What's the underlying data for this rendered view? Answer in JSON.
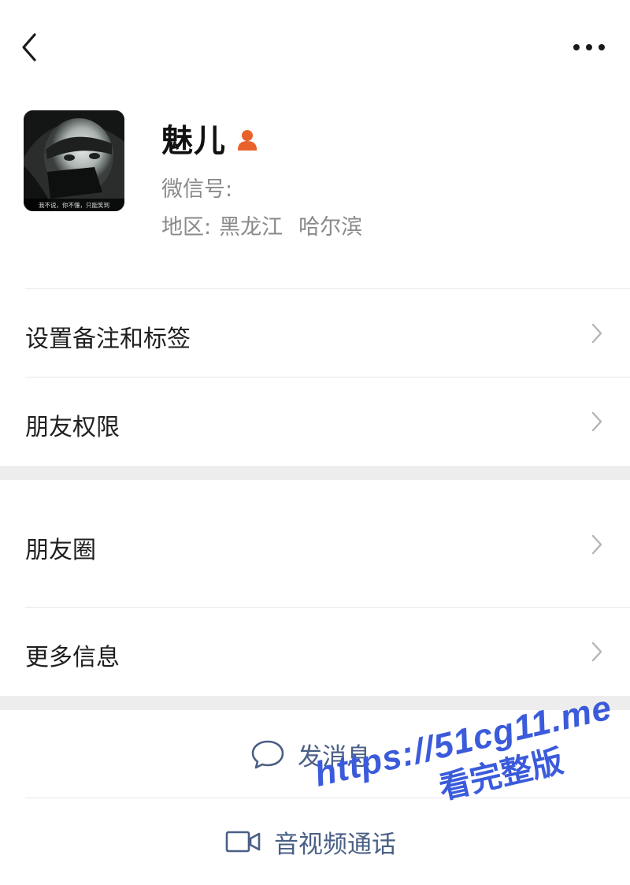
{
  "profile": {
    "name": "魅儿",
    "wechat_id_label": "微信号:",
    "region_label": "地区:",
    "province": "黑龙江",
    "city": "哈尔滨",
    "avatar_caption": "我不说，你不懂，只能笑到",
    "gender_icon_color": "#e8622c"
  },
  "menu": {
    "remark_label": "设置备注和标签",
    "permissions_label": "朋友权限",
    "moments_label": "朋友圈",
    "more_info_label": "更多信息"
  },
  "actions": {
    "message_label": "发消息",
    "call_label": "音视频通话"
  },
  "watermark": {
    "url": "https://51cg11.me",
    "text": "看完整版"
  },
  "icons": {
    "back": "back-arrow-icon",
    "more": "more-dots-icon",
    "chevron": "chevron-right-icon",
    "chat": "chat-bubble-icon",
    "video": "video-camera-icon",
    "gender": "person-icon"
  },
  "colors": {
    "action_text": "#4a5f85",
    "secondary_text": "#8a8a8a",
    "section_gap": "#ededed"
  }
}
